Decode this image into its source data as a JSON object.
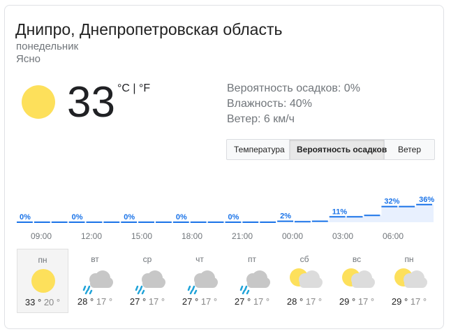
{
  "header": {
    "location": "Днипро, Днепропетровская область",
    "day": "понедельник",
    "condition": "Ясно"
  },
  "current": {
    "temperature": "33",
    "unit_c": "°C",
    "unit_sep": " | ",
    "unit_f": "°F",
    "icon": "sun-icon",
    "precip": "Вероятность осадков: 0%",
    "humidity": "Влажность: 40%",
    "wind": "Ветер: 6 км/ч"
  },
  "tabs": [
    {
      "label": "Температура",
      "active": false
    },
    {
      "label": "Вероятность осадков",
      "active": true
    },
    {
      "label": "Ветер",
      "active": false
    }
  ],
  "chart_data": {
    "type": "area",
    "x": [
      "09:00",
      "12:00",
      "15:00",
      "18:00",
      "21:00",
      "00:00",
      "03:00",
      "06:00"
    ],
    "values": [
      0,
      0,
      0,
      0,
      0,
      2,
      11,
      32,
      36
    ],
    "labels": [
      "0%",
      "0%",
      "0%",
      "0%",
      "0%",
      "2%",
      "11%",
      "32%",
      "36%"
    ],
    "ylim": [
      0,
      100
    ],
    "color": "#1a73e8",
    "fill": "#e8f0fe"
  },
  "forecast": [
    {
      "day": "пн",
      "icon": "sun",
      "hi": "33 °",
      "lo": "20 °",
      "selected": true
    },
    {
      "day": "вт",
      "icon": "rain",
      "hi": "28 °",
      "lo": "17 °",
      "selected": false
    },
    {
      "day": "ср",
      "icon": "rain",
      "hi": "27 °",
      "lo": "17 °",
      "selected": false
    },
    {
      "day": "чт",
      "icon": "rain",
      "hi": "27 °",
      "lo": "17 °",
      "selected": false
    },
    {
      "day": "пт",
      "icon": "rain",
      "hi": "27 °",
      "lo": "17 °",
      "selected": false
    },
    {
      "day": "сб",
      "icon": "partly-cloudy",
      "hi": "28 °",
      "lo": "17 °",
      "selected": false
    },
    {
      "day": "вс",
      "icon": "partly-cloudy",
      "hi": "29 °",
      "lo": "17 °",
      "selected": false
    },
    {
      "day": "пн",
      "icon": "partly-cloudy",
      "hi": "29 °",
      "lo": "17 °",
      "selected": false
    }
  ]
}
